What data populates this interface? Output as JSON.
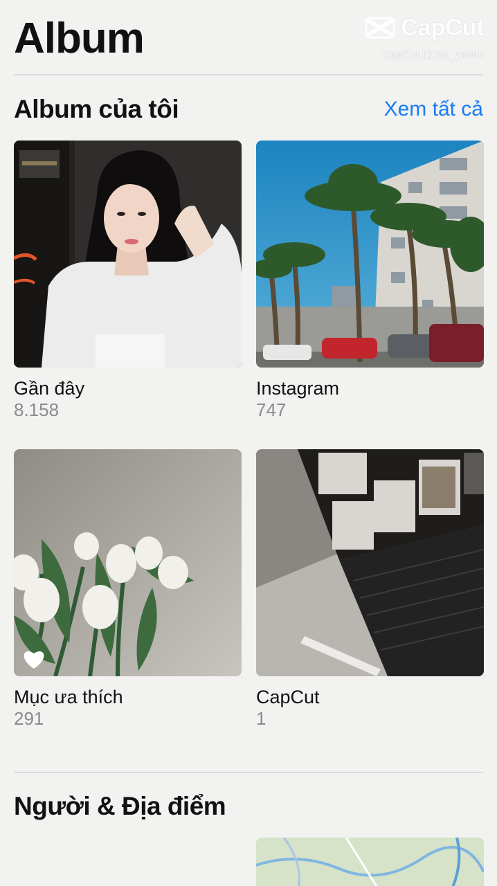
{
  "header": {
    "title": "Album"
  },
  "watermark": {
    "logo_text": "CapCut",
    "id_text": "CapCut ID:nc_yennn"
  },
  "my_albums": {
    "title": "Album của tôi",
    "see_all_label": "Xem tất cả",
    "albums": [
      {
        "name": "Gần đây",
        "count": "8.158"
      },
      {
        "name": "Instagram",
        "count": "747"
      },
      {
        "name": "Mục ưa thích",
        "count": "291"
      },
      {
        "name": "CapCut",
        "count": "1"
      }
    ]
  },
  "people_places": {
    "title": "Người & Địa điểm"
  },
  "colors": {
    "background": "#f2f2f1",
    "link": "#1a7cf4",
    "secondary_text": "#8b8b8b",
    "divider": "#dcdcdc"
  },
  "icons": [
    "capcut-logo-icon",
    "heart-icon"
  ]
}
